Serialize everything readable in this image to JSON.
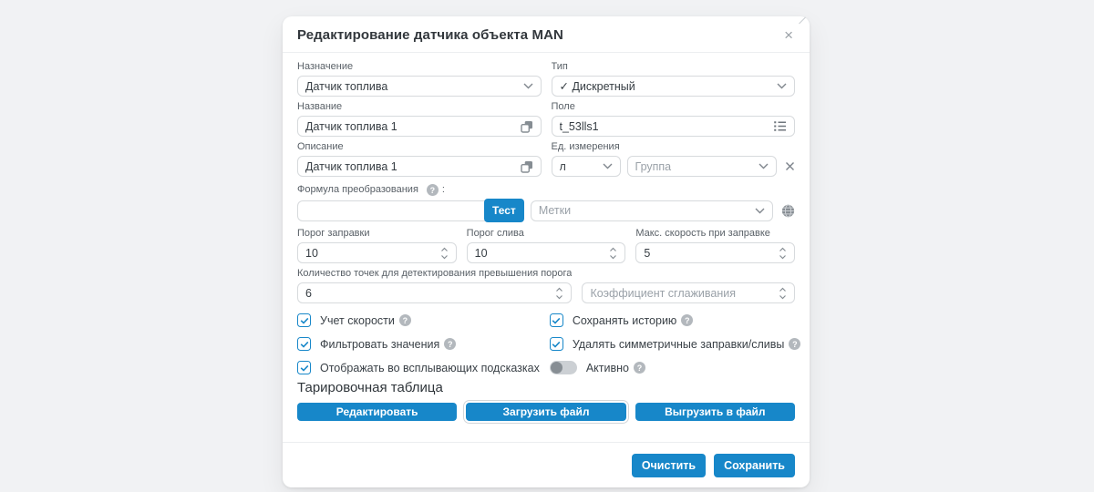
{
  "icons": {
    "help_glyph": "?",
    "close_glyph": "×"
  },
  "colors": {
    "accent_blue": "#1787c9",
    "page_bg": "#f1f2f4"
  },
  "modal": {
    "title": "Редактирование датчика объекта MAN"
  },
  "form": {
    "purpose": {
      "label": "Назначение",
      "value": "Датчик топлива"
    },
    "type": {
      "label": "Тип",
      "value": "✓ Дискретный"
    },
    "name": {
      "label": "Название",
      "value": "Датчик топлива 1"
    },
    "field": {
      "label": "Поле",
      "value": "t_53lls1"
    },
    "description": {
      "label": "Описание",
      "value": "Датчик топлива 1"
    },
    "unit": {
      "label": "Ед. измерения",
      "value": "л"
    },
    "group": {
      "placeholder": "Группа"
    },
    "formula": {
      "label": "Формула преобразования",
      "suffix": ":",
      "value": "",
      "test_button": "Тест"
    },
    "tags": {
      "placeholder": "Метки"
    },
    "fill_threshold": {
      "label": "Порог заправки",
      "value": "10"
    },
    "drain_threshold": {
      "label": "Порог слива",
      "value": "10"
    },
    "max_fill_speed": {
      "label": "Макс. скорость при заправке",
      "value": "5"
    },
    "points_count": {
      "label": "Количество точек для детектирования превышения порога",
      "value": "6"
    },
    "smoothing": {
      "placeholder": "Коэффициент сглаживания"
    },
    "checks": {
      "speed": {
        "label": "Учет скорости",
        "checked": true
      },
      "history": {
        "label": "Сохранять историю",
        "checked": true
      },
      "filter": {
        "label": "Фильтровать значения",
        "checked": true
      },
      "symmetric": {
        "label": "Удалять симметричные заправки/сливы",
        "checked": true
      },
      "tooltips": {
        "label": "Отображать во всплывающих подсказках",
        "checked": true
      },
      "active": {
        "label": "Активно",
        "state": "off"
      }
    },
    "calibration": {
      "heading": "Тарировочная таблица",
      "edit_button": "Редактировать",
      "upload_button": "Загрузить файл",
      "download_button": "Выгрузить в файл"
    }
  },
  "footer": {
    "clear_button": "Очистить",
    "save_button": "Сохранить"
  }
}
